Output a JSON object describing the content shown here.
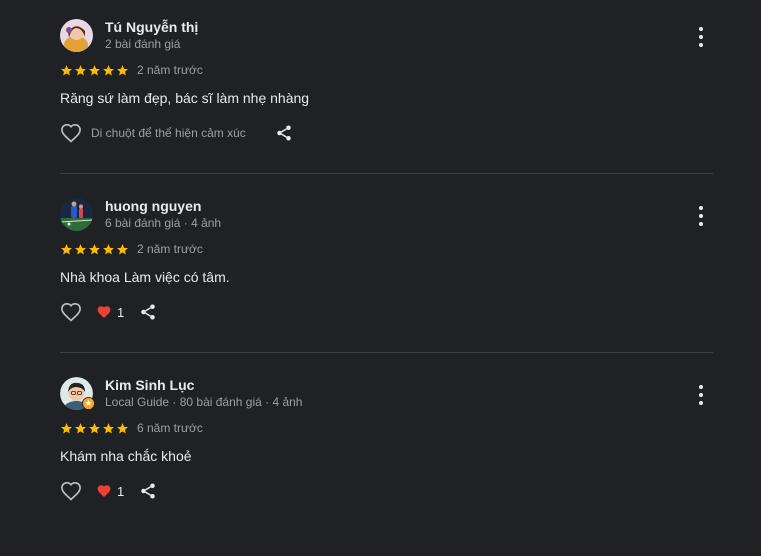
{
  "reviews": [
    {
      "name": "Tú Nguyễn thị",
      "meta": "2 bài đánh giá",
      "rating": 5,
      "time": "2 năm trước",
      "text": "Răng sứ làm đẹp, bác sĩ làm nhẹ nhàng",
      "reaction_hint": "Di chuột để thể hiện cảm xúc",
      "reaction_count": null,
      "avatar_icon": "woman-portrait-avatar"
    },
    {
      "name": "huong nguyen",
      "meta": "6 bài đánh giá · 4 ảnh",
      "rating": 5,
      "time": "2 năm trước",
      "text": "Nhà khoa Làm việc có tâm.",
      "reaction_hint": null,
      "reaction_count": "1",
      "avatar_icon": "football-field-avatar"
    },
    {
      "name": "Kim Sinh Lục",
      "meta": "Local Guide · 80 bài đánh giá · 4 ảnh",
      "rating": 5,
      "time": "6 năm trước",
      "text": "Khám nha chắc khoẻ",
      "reaction_hint": null,
      "reaction_count": "1",
      "avatar_icon": "man-portrait-avatar",
      "badge": "local-guide-badge"
    }
  ],
  "colors": {
    "background": "#202124",
    "star": "#fbbc04",
    "heart_filled": "#ea4335",
    "badge": "#f9a825"
  }
}
